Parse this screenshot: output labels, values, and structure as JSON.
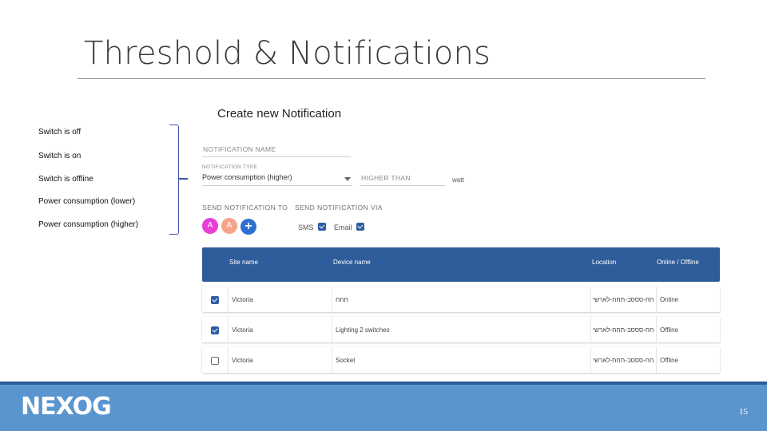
{
  "slide": {
    "title": "Threshold & Notifications",
    "page_number": "15"
  },
  "legend": {
    "items": [
      "Switch is off",
      "Switch is on",
      "Switch is offline",
      "Power consumption (lower)",
      "Power consumption (higher)"
    ]
  },
  "form": {
    "title": "Create new Notification",
    "name_placeholder": "NOTIFICATION NAME",
    "type_label": "NOTIFICATION TYPE",
    "type_value": "Power consumption (higher)",
    "threshold_placeholder": "HIGHER THAN",
    "unit": "watt",
    "send_to_label": "SEND NOTIFICATION TO",
    "send_via_label": "SEND NOTIFICATION VIA",
    "avatars": [
      {
        "initial": "A",
        "color": "#e83fd6"
      },
      {
        "initial": "A",
        "color": "#f5a48a"
      }
    ],
    "add_icon": "+",
    "channels": [
      {
        "label": "SMS",
        "checked": true
      },
      {
        "label": "Email",
        "checked": true
      }
    ]
  },
  "table": {
    "columns": [
      "Site name",
      "Device name",
      "Location",
      "Online / Offline"
    ],
    "rows": [
      {
        "checked": true,
        "site": "Victoria",
        "device": "חחח",
        "location": "חח-סססב-תחח-לארשי",
        "status": "Online"
      },
      {
        "checked": true,
        "site": "Victoria",
        "device": "Lighting 2 switches",
        "location": "חח-סססב-תחח-לארשי",
        "status": "Offline"
      },
      {
        "checked": false,
        "site": "Victoria",
        "device": "Socket",
        "location": "חח-סססב-תחח-לארשי",
        "status": "Offline"
      }
    ]
  },
  "footer": {
    "logo_text": "NEXOG"
  },
  "colors": {
    "accent": "#2f5c9b",
    "footer": "#5a95cf",
    "bracket": "#3b55a6"
  }
}
